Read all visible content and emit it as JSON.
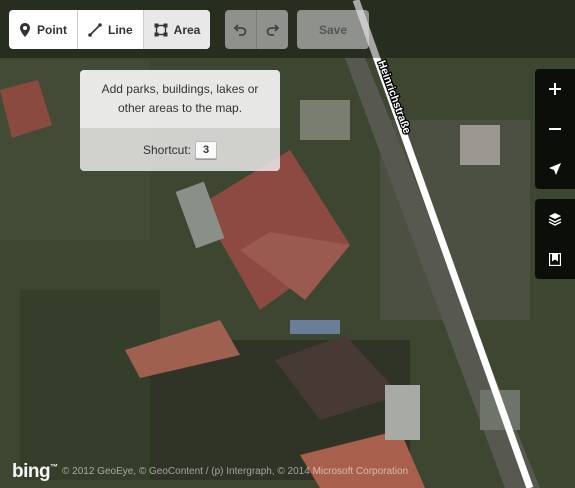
{
  "toolbar": {
    "modes": [
      {
        "label": "Point",
        "icon": "point-icon"
      },
      {
        "label": "Line",
        "icon": "line-icon"
      },
      {
        "label": "Area",
        "icon": "area-icon",
        "active": true
      }
    ],
    "undo_icon": "undo-icon",
    "redo_icon": "redo-icon",
    "save_label": "Save"
  },
  "tooltip": {
    "text": "Add parks, buildings, lakes or other areas to the map.",
    "shortcut_label": "Shortcut:",
    "shortcut_key": "3"
  },
  "map": {
    "street_name": "Heinrichstraße",
    "controls": [
      {
        "name": "zoom-in",
        "icon": "plus-icon"
      },
      {
        "name": "zoom-out",
        "icon": "minus-icon"
      },
      {
        "name": "locate",
        "icon": "location-arrow-icon"
      },
      {
        "name": "background",
        "icon": "layers-icon"
      },
      {
        "name": "help",
        "icon": "book-icon"
      }
    ]
  },
  "footer": {
    "logo": "bing",
    "attribution": "© 2012 GeoEye, © GeoContent / (p) Intergraph, © 2014 Microsoft Corporation"
  },
  "colors": {
    "road": "#ffffff",
    "aerial_base": "#3c4630",
    "control_bg": "#000000"
  }
}
